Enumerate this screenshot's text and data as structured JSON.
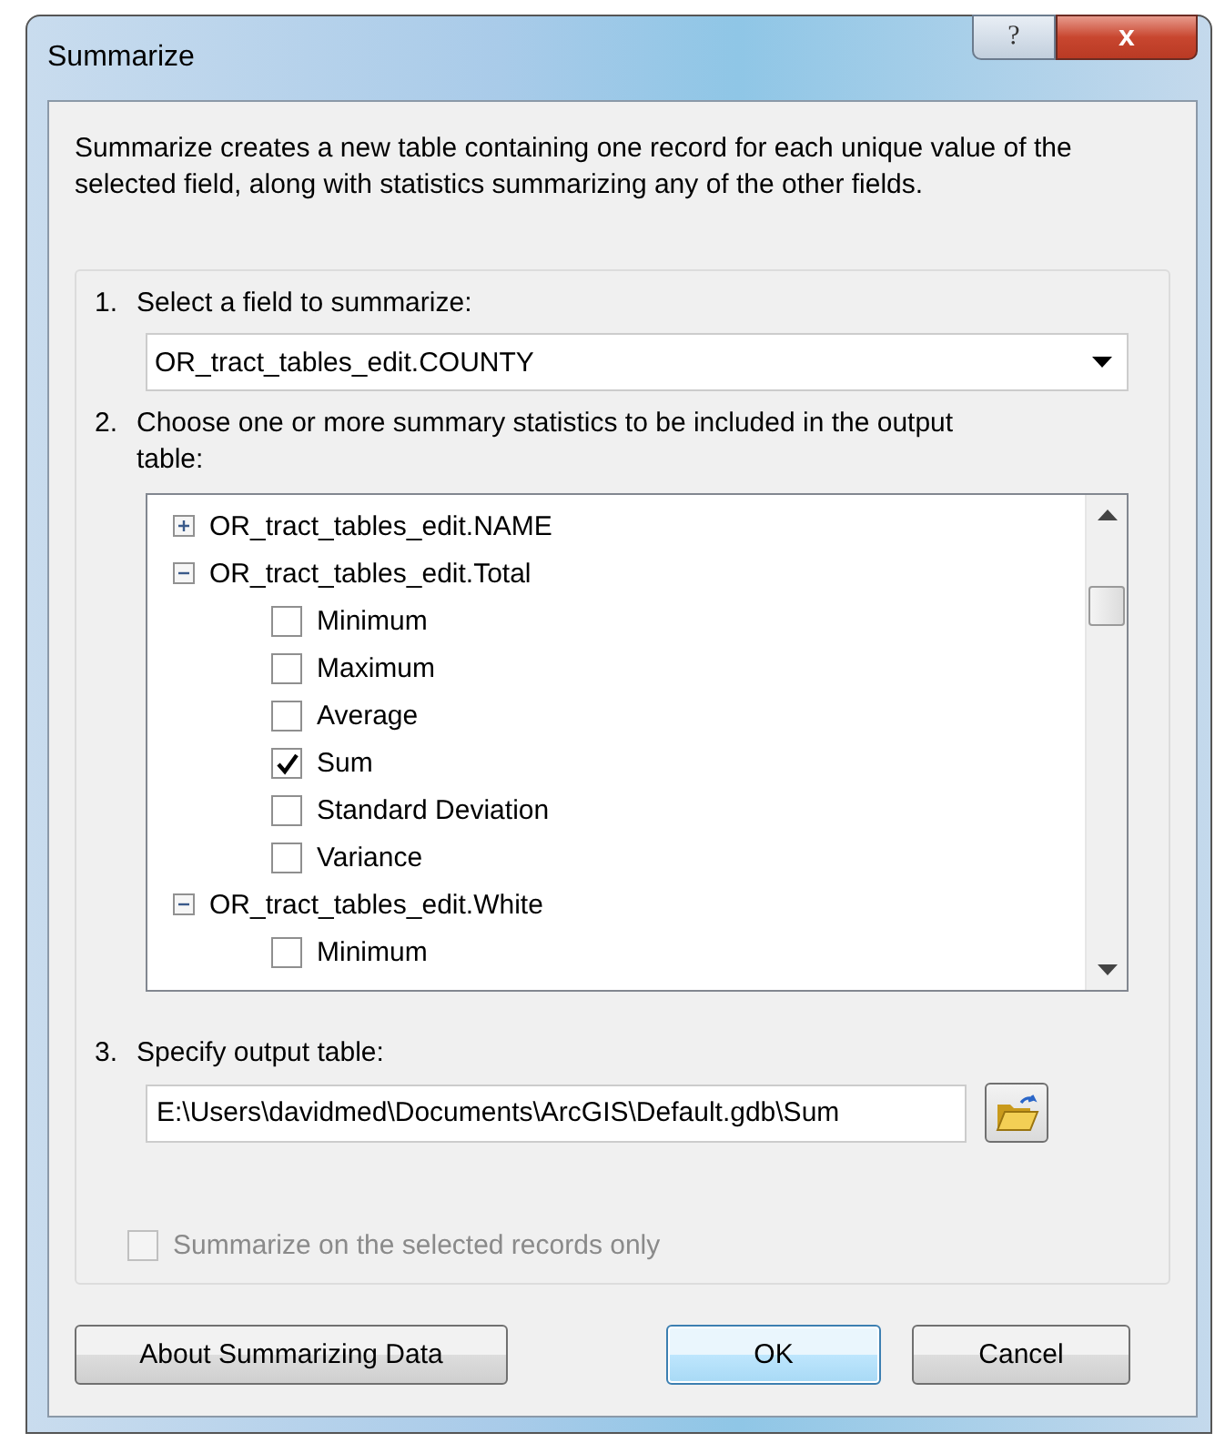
{
  "window": {
    "title": "Summarize",
    "help": "?",
    "close": "x"
  },
  "description": "Summarize creates a new table containing one record for each unique value of the selected field, along with statistics summarizing any of the other fields.",
  "step1": {
    "number": "1.",
    "label": "Select a field to summarize:",
    "value": "OR_tract_tables_edit.COUNTY"
  },
  "step2": {
    "number": "2.",
    "label": "Choose one or more summary statistics to be included in the output table:"
  },
  "tree": [
    {
      "label": "OR_tract_tables_edit.NAME",
      "expanded": false
    },
    {
      "label": "OR_tract_tables_edit.Total",
      "expanded": true,
      "children": [
        {
          "label": "Minimum",
          "checked": false
        },
        {
          "label": "Maximum",
          "checked": false
        },
        {
          "label": "Average",
          "checked": false
        },
        {
          "label": "Sum",
          "checked": true
        },
        {
          "label": "Standard Deviation",
          "checked": false
        },
        {
          "label": "Variance",
          "checked": false
        }
      ]
    },
    {
      "label": "OR_tract_tables_edit.White",
      "expanded": true,
      "children": [
        {
          "label": "Minimum",
          "checked": false
        }
      ]
    }
  ],
  "step3": {
    "number": "3.",
    "label": "Specify output table:",
    "value": "E:\\Users\\davidmed\\Documents\\ArcGIS\\Default.gdb\\Sum"
  },
  "selected_only": {
    "label": "Summarize on the selected records only",
    "checked": false,
    "disabled": true
  },
  "buttons": [
    {
      "label": "About Summarizing Data",
      "default": false
    },
    {
      "label": "OK",
      "default": true
    },
    {
      "label": "Cancel",
      "default": false
    }
  ]
}
